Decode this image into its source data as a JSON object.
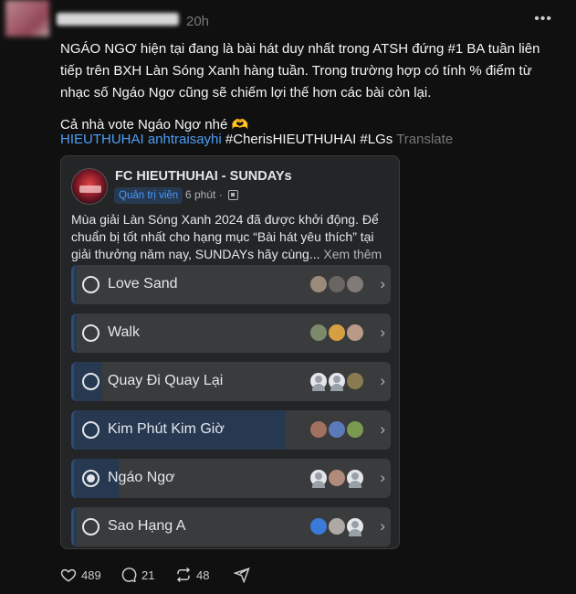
{
  "header": {
    "timestamp": "20h",
    "more_icon": "more-horizontal-icon"
  },
  "post": {
    "paragraphs": [
      "NGÁO NGƠ hiện tại đang là bài hát duy nhất trong ATSH đứng #1 BA tuần liên tiếp trên BXH Làn Sóng Xanh hàng tuần. Trong trường hợp có tính % điểm từ nhạc số Ngáo Ngơ cũng sẽ chiếm lợi thế hơn các bài còn lại.",
      "Cả nhà vote Ngáo Ngơ nhé 🫶"
    ],
    "hashtags": {
      "tag1": "HIEUTHUHAI anhtraisayhi",
      "tag2": "#CherisHIEUTHUHAI #LGs",
      "translate": "Translate"
    }
  },
  "shared": {
    "page_name": "FC HIEUTHUHAI - SUNDAYs",
    "badge": "Quản trị viên",
    "time": "6 phút",
    "dot": "·",
    "desc": "Mùa giải Làn Sóng Xanh 2024 đã được khởi động. Để chuẩn bị tốt nhất cho hạng mục “Bài hát yêu thích” tại giải thưởng năm nay, SUNDAYs hãy cùng...",
    "see_more": "Xem thêm",
    "poll": [
      {
        "label": "Love Sand",
        "fill": 0.01,
        "checked": false
      },
      {
        "label": "Walk",
        "fill": 0.01,
        "checked": false
      },
      {
        "label": "Quay Đi Quay Lại",
        "fill": 0.09,
        "checked": false
      },
      {
        "label": "Kim Phút Kim Giờ",
        "fill": 0.67,
        "checked": false
      },
      {
        "label": "Ngáo Ngơ",
        "fill": 0.14,
        "checked": true
      },
      {
        "label": "Sao Hạng A",
        "fill": 0.01,
        "checked": false
      }
    ]
  },
  "actions": {
    "likes": "489",
    "comments": "21",
    "reposts": "48"
  },
  "colors": {
    "background": "#101010",
    "link_blue": "#4d9ef5",
    "card": "#242526",
    "poll_fill": "#263951"
  }
}
